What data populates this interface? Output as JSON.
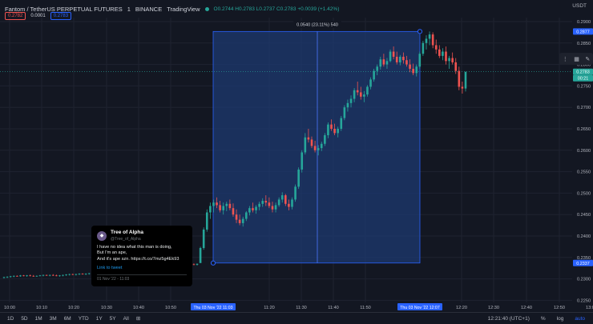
{
  "header": {
    "symbol": "Fantom / TetherUS PERPETUAL FUTURES",
    "interval": "1",
    "exchange": "BINANCE",
    "source": "TradingView",
    "ohlc": "O0.2744 H0.2783 L0.2737 C0.2783 +0.0039 (+1.42%)",
    "currency": "USDT"
  },
  "price_boxes": {
    "sell": "0.2782",
    "spread": "0.0001",
    "buy": "0.2783"
  },
  "measure_label": "0.0540 (23.11%) 540",
  "tweet": {
    "name": "Tree of Alpha",
    "handle": "@Tree_of_Alpha",
    "lines": [
      "I have no idea what this man is doing,",
      "But I'm an ape,",
      "And it's ape szn. https://t.co/7mz5g4Ek93"
    ],
    "link": "Link to tweet",
    "date": "01 Nov '22 - 11:03"
  },
  "bottom": {
    "timeframes": [
      "1D",
      "5D",
      "1M",
      "3M",
      "6M",
      "YTD",
      "1Y",
      "5Y",
      "All"
    ],
    "clock": "12:21:40 (UTC+1)",
    "pct": "%",
    "log": "log",
    "auto": "auto"
  },
  "colors": {
    "up": "#26a69a",
    "down": "#ef5350",
    "accent": "#2962ff",
    "measure_fill": "#1e3a70"
  },
  "chart_data": {
    "type": "candlestick",
    "ylim": [
      0.225,
      0.29
    ],
    "y_ticks": [
      "0.2900",
      "0.2850",
      "0.2800",
      "0.2750",
      "0.2700",
      "0.2650",
      "0.2600",
      "0.2550",
      "0.2500",
      "0.2450",
      "0.2400",
      "0.2350",
      "0.2300",
      "0.2250"
    ],
    "x_ticks": [
      "10:00",
      "10:10",
      "10:20",
      "10:30",
      "10:40",
      "10:50",
      "11:20",
      "11:30",
      "11:40",
      "11:50",
      "12:20",
      "12:30",
      "12:40",
      "12:50",
      "13:00"
    ],
    "highlight_x": [
      "Thu 03 Nov '22  11:03",
      "Thu 03 Nov '22  12:07"
    ],
    "price_labels": {
      "high": "0.2877",
      "last": "0.2783",
      "countdown": "00:21",
      "low": "0.2337"
    },
    "candles_ohlc": [
      [
        0.2303,
        0.2305,
        0.2301,
        0.2304
      ],
      [
        0.2304,
        0.2306,
        0.2302,
        0.2305
      ],
      [
        0.2305,
        0.2307,
        0.2303,
        0.2306
      ],
      [
        0.2306,
        0.2308,
        0.2304,
        0.2307
      ],
      [
        0.2307,
        0.2308,
        0.2305,
        0.2306
      ],
      [
        0.2306,
        0.2309,
        0.2305,
        0.2308
      ],
      [
        0.2308,
        0.2309,
        0.2306,
        0.2307
      ],
      [
        0.2307,
        0.2309,
        0.2305,
        0.2308
      ],
      [
        0.2308,
        0.231,
        0.2306,
        0.2307
      ],
      [
        0.2307,
        0.2309,
        0.2305,
        0.2306
      ],
      [
        0.2306,
        0.2308,
        0.2305,
        0.2307
      ],
      [
        0.2307,
        0.2309,
        0.2306,
        0.2308
      ],
      [
        0.2308,
        0.231,
        0.2306,
        0.2309
      ],
      [
        0.2309,
        0.231,
        0.2307,
        0.2308
      ],
      [
        0.2308,
        0.231,
        0.2306,
        0.2309
      ],
      [
        0.2309,
        0.2311,
        0.2307,
        0.2308
      ],
      [
        0.2308,
        0.231,
        0.2306,
        0.2307
      ],
      [
        0.2307,
        0.2309,
        0.2305,
        0.2308
      ],
      [
        0.2308,
        0.231,
        0.2306,
        0.2309
      ],
      [
        0.2309,
        0.2311,
        0.2307,
        0.231
      ],
      [
        0.231,
        0.2312,
        0.2308,
        0.2311
      ],
      [
        0.2311,
        0.2312,
        0.2309,
        0.231
      ],
      [
        0.231,
        0.2312,
        0.2308,
        0.2311
      ],
      [
        0.2311,
        0.2313,
        0.2309,
        0.2312
      ],
      [
        0.2312,
        0.2313,
        0.231,
        0.2311
      ],
      [
        0.2311,
        0.2313,
        0.2309,
        0.2312
      ],
      [
        0.2312,
        0.2314,
        0.231,
        0.2313
      ],
      [
        0.2313,
        0.2315,
        0.2311,
        0.2314
      ],
      [
        0.2314,
        0.2316,
        0.2312,
        0.2315
      ],
      [
        0.2315,
        0.2317,
        0.2313,
        0.2316
      ],
      [
        0.2316,
        0.2318,
        0.2314,
        0.2317
      ],
      [
        0.2317,
        0.2318,
        0.2315,
        0.2316
      ],
      [
        0.2316,
        0.2318,
        0.2314,
        0.2317
      ],
      [
        0.2317,
        0.2319,
        0.2315,
        0.2318
      ],
      [
        0.2318,
        0.232,
        0.2316,
        0.2319
      ],
      [
        0.2319,
        0.232,
        0.2317,
        0.2318
      ],
      [
        0.2318,
        0.232,
        0.2316,
        0.2317
      ],
      [
        0.2317,
        0.2319,
        0.2315,
        0.2318
      ],
      [
        0.2318,
        0.232,
        0.2316,
        0.2319
      ],
      [
        0.2319,
        0.2321,
        0.2317,
        0.232
      ],
      [
        0.232,
        0.2322,
        0.2318,
        0.2321
      ],
      [
        0.2321,
        0.2322,
        0.2319,
        0.232
      ],
      [
        0.232,
        0.2322,
        0.2318,
        0.2321
      ],
      [
        0.2321,
        0.2323,
        0.2319,
        0.2322
      ],
      [
        0.2322,
        0.2324,
        0.232,
        0.2323
      ],
      [
        0.2323,
        0.2324,
        0.2321,
        0.2322
      ],
      [
        0.2322,
        0.2324,
        0.232,
        0.2323
      ],
      [
        0.2323,
        0.2325,
        0.2321,
        0.2324
      ],
      [
        0.2324,
        0.2326,
        0.2322,
        0.2325
      ],
      [
        0.2325,
        0.2326,
        0.2323,
        0.2324
      ],
      [
        0.2324,
        0.2326,
        0.2322,
        0.2325
      ],
      [
        0.2325,
        0.2327,
        0.2323,
        0.2326
      ],
      [
        0.2326,
        0.2328,
        0.2324,
        0.2327
      ],
      [
        0.2327,
        0.2328,
        0.2325,
        0.2326
      ],
      [
        0.2326,
        0.233,
        0.2324,
        0.2328
      ],
      [
        0.2328,
        0.2332,
        0.2326,
        0.233
      ],
      [
        0.233,
        0.2334,
        0.2328,
        0.2332
      ],
      [
        0.2332,
        0.2336,
        0.233,
        0.2334
      ],
      [
        0.2334,
        0.2336,
        0.2332,
        0.2333
      ],
      [
        0.2333,
        0.2336,
        0.2331,
        0.2335
      ],
      [
        0.2337,
        0.2375,
        0.2337,
        0.2372
      ],
      [
        0.2372,
        0.242,
        0.2368,
        0.2415
      ],
      [
        0.2415,
        0.2462,
        0.241,
        0.2455
      ],
      [
        0.2455,
        0.2478,
        0.244,
        0.247
      ],
      [
        0.247,
        0.2485,
        0.2455,
        0.2478
      ],
      [
        0.2478,
        0.249,
        0.2465,
        0.2472
      ],
      [
        0.2472,
        0.2482,
        0.2455,
        0.246
      ],
      [
        0.246,
        0.2478,
        0.245,
        0.247
      ],
      [
        0.247,
        0.248,
        0.2458,
        0.2475
      ],
      [
        0.2475,
        0.2485,
        0.246,
        0.2465
      ],
      [
        0.2465,
        0.2476,
        0.2445,
        0.245
      ],
      [
        0.245,
        0.2462,
        0.243,
        0.2438
      ],
      [
        0.2438,
        0.245,
        0.2425,
        0.243
      ],
      [
        0.243,
        0.2445,
        0.2422,
        0.244
      ],
      [
        0.244,
        0.2458,
        0.2435,
        0.2455
      ],
      [
        0.2455,
        0.247,
        0.2448,
        0.2465
      ],
      [
        0.2465,
        0.2478,
        0.2455,
        0.246
      ],
      [
        0.246,
        0.2472,
        0.2452,
        0.2468
      ],
      [
        0.2468,
        0.248,
        0.246,
        0.2475
      ],
      [
        0.2475,
        0.2488,
        0.2468,
        0.2482
      ],
      [
        0.2482,
        0.2495,
        0.247,
        0.2478
      ],
      [
        0.2478,
        0.249,
        0.2465,
        0.247
      ],
      [
        0.247,
        0.248,
        0.2455,
        0.2462
      ],
      [
        0.2462,
        0.2478,
        0.2455,
        0.2472
      ],
      [
        0.2472,
        0.249,
        0.2468,
        0.2485
      ],
      [
        0.2485,
        0.2502,
        0.2478,
        0.2495
      ],
      [
        0.2495,
        0.2498,
        0.247,
        0.2475
      ],
      [
        0.2475,
        0.2485,
        0.246,
        0.2468
      ],
      [
        0.2468,
        0.249,
        0.2462,
        0.2485
      ],
      [
        0.2485,
        0.252,
        0.248,
        0.2515
      ],
      [
        0.2515,
        0.256,
        0.251,
        0.2555
      ],
      [
        0.2555,
        0.26,
        0.2548,
        0.2595
      ],
      [
        0.2595,
        0.264,
        0.259,
        0.263
      ],
      [
        0.263,
        0.265,
        0.2618,
        0.2625
      ],
      [
        0.2625,
        0.2632,
        0.2605,
        0.261
      ],
      [
        0.261,
        0.2622,
        0.2595,
        0.26
      ],
      [
        0.26,
        0.2612,
        0.2588,
        0.2605
      ],
      [
        0.2605,
        0.262,
        0.2598,
        0.2615
      ],
      [
        0.2615,
        0.264,
        0.261,
        0.2635
      ],
      [
        0.2635,
        0.2665,
        0.2628,
        0.266
      ],
      [
        0.266,
        0.2672,
        0.2645,
        0.265
      ],
      [
        0.265,
        0.2662,
        0.2635,
        0.264
      ],
      [
        0.264,
        0.2655,
        0.263,
        0.265
      ],
      [
        0.265,
        0.268,
        0.2645,
        0.2675
      ],
      [
        0.2675,
        0.2705,
        0.267,
        0.27
      ],
      [
        0.27,
        0.2718,
        0.269,
        0.271
      ],
      [
        0.271,
        0.2728,
        0.27,
        0.272
      ],
      [
        0.272,
        0.2745,
        0.2712,
        0.274
      ],
      [
        0.274,
        0.276,
        0.2728,
        0.2735
      ],
      [
        0.2735,
        0.2748,
        0.2718,
        0.2725
      ],
      [
        0.2725,
        0.2738,
        0.2712,
        0.273
      ],
      [
        0.273,
        0.2752,
        0.2725,
        0.2748
      ],
      [
        0.2748,
        0.277,
        0.2742,
        0.2765
      ],
      [
        0.2765,
        0.279,
        0.276,
        0.2785
      ],
      [
        0.2785,
        0.28,
        0.2775,
        0.2795
      ],
      [
        0.2795,
        0.2818,
        0.2788,
        0.2812
      ],
      [
        0.2812,
        0.2825,
        0.2795,
        0.28
      ],
      [
        0.28,
        0.2815,
        0.279,
        0.2808
      ],
      [
        0.2808,
        0.2835,
        0.2805,
        0.283
      ],
      [
        0.283,
        0.2842,
        0.2812,
        0.2818
      ],
      [
        0.2818,
        0.283,
        0.28,
        0.2805
      ],
      [
        0.2805,
        0.2822,
        0.2798,
        0.2818
      ],
      [
        0.2818,
        0.2828,
        0.2802,
        0.281
      ],
      [
        0.281,
        0.282,
        0.2795,
        0.28
      ],
      [
        0.28,
        0.2812,
        0.2782,
        0.279
      ],
      [
        0.279,
        0.2802,
        0.2775,
        0.278
      ],
      [
        0.278,
        0.28,
        0.2772,
        0.2795
      ],
      [
        0.2795,
        0.283,
        0.279,
        0.2825
      ],
      [
        0.2825,
        0.2855,
        0.282,
        0.285
      ],
      [
        0.285,
        0.2868,
        0.2835,
        0.286
      ],
      [
        0.286,
        0.2877,
        0.2845,
        0.287
      ],
      [
        0.287,
        0.2875,
        0.2838,
        0.2845
      ],
      [
        0.2845,
        0.2858,
        0.2825,
        0.2835
      ],
      [
        0.2835,
        0.2845,
        0.2815,
        0.282
      ],
      [
        0.282,
        0.2838,
        0.281,
        0.283
      ],
      [
        0.283,
        0.2842,
        0.28,
        0.2808
      ],
      [
        0.2808,
        0.282,
        0.279,
        0.2815
      ],
      [
        0.2815,
        0.2828,
        0.28,
        0.2805
      ],
      [
        0.2805,
        0.2815,
        0.2778,
        0.2785
      ],
      [
        0.2785,
        0.2795,
        0.274,
        0.2748
      ],
      [
        0.2748,
        0.276,
        0.2732,
        0.2744
      ],
      [
        0.2744,
        0.2783,
        0.2737,
        0.2783
      ]
    ]
  }
}
